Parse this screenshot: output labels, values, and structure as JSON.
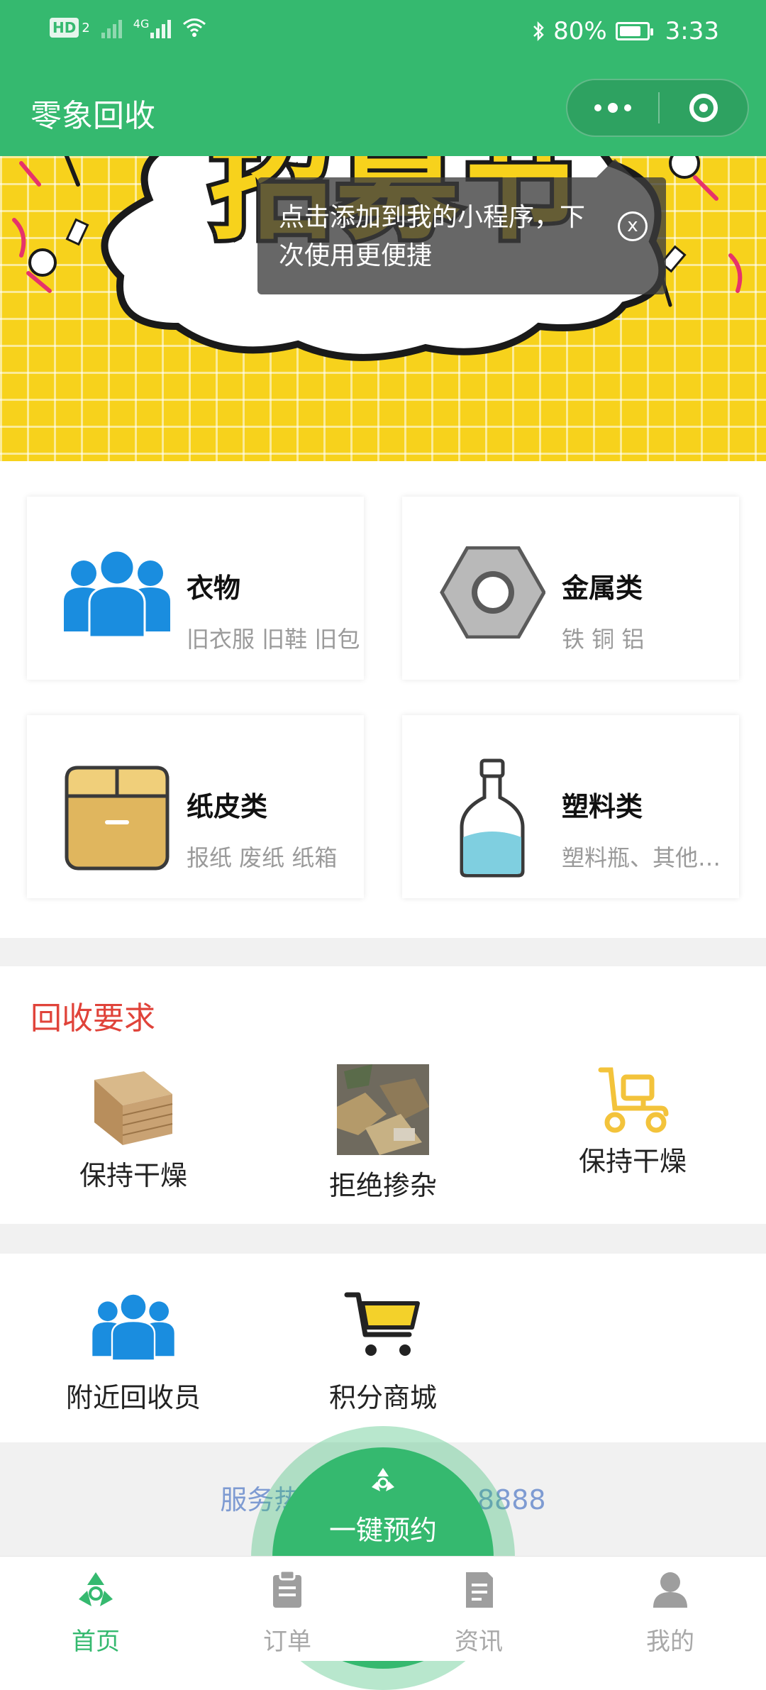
{
  "status_bar": {
    "hd": "HD",
    "sim": "2",
    "network": "4G",
    "battery": "80%",
    "battery_level": 0.8,
    "time": "3:33"
  },
  "title_bar": {
    "title": "零象回收",
    "more_icon": "more-dots-icon",
    "close_icon": "target-circle-icon"
  },
  "banner": {
    "headline": "招募节",
    "colors": {
      "background": "#f7d21c",
      "text": "#f7d21c",
      "outline": "#1a1a1a"
    }
  },
  "tooltip": {
    "text_line1": "点击添加到我的小程序，下",
    "text_line2": "次使用更便捷",
    "close_label": "x"
  },
  "categories": [
    {
      "name": "衣物",
      "sub": "旧衣服 旧鞋 旧包",
      "icon": "people-icon"
    },
    {
      "name": "金属类",
      "sub": "铁 铜 铝",
      "icon": "hex-nut-icon"
    },
    {
      "name": "纸皮类",
      "sub": "报纸 废纸 纸箱",
      "icon": "cardboard-box-icon"
    },
    {
      "name": "塑料类",
      "sub": "塑料瓶、其他塑料",
      "icon": "bottle-icon"
    }
  ],
  "requirements": {
    "heading": "回收要求",
    "items": [
      {
        "label": "保持干燥",
        "icon": "cardboard-stack-image"
      },
      {
        "label": "拒绝掺杂",
        "icon": "mixed-waste-image"
      },
      {
        "label": "保持干燥",
        "icon": "delivery-scooter-icon"
      }
    ]
  },
  "tools": [
    {
      "label": "附近回收员",
      "icon": "people-icon"
    },
    {
      "label": "积分商城",
      "icon": "shopping-cart-icon"
    }
  ],
  "service_phone": {
    "text": "服务热线：400-888-8888"
  },
  "fab": {
    "label": "一键预约",
    "icon": "recycle-icon"
  },
  "tabbar": [
    {
      "label": "首页",
      "icon": "recycle-icon",
      "active": true
    },
    {
      "label": "订单",
      "icon": "clipboard-icon",
      "active": false
    },
    {
      "label": "资讯",
      "icon": "document-icon",
      "active": false
    },
    {
      "label": "我的",
      "icon": "user-icon",
      "active": false
    }
  ],
  "colors": {
    "primary": "#35b96f",
    "heading_red": "#e0433a",
    "phone_blue": "#7e9bd2",
    "muted": "#9a9a9a"
  }
}
